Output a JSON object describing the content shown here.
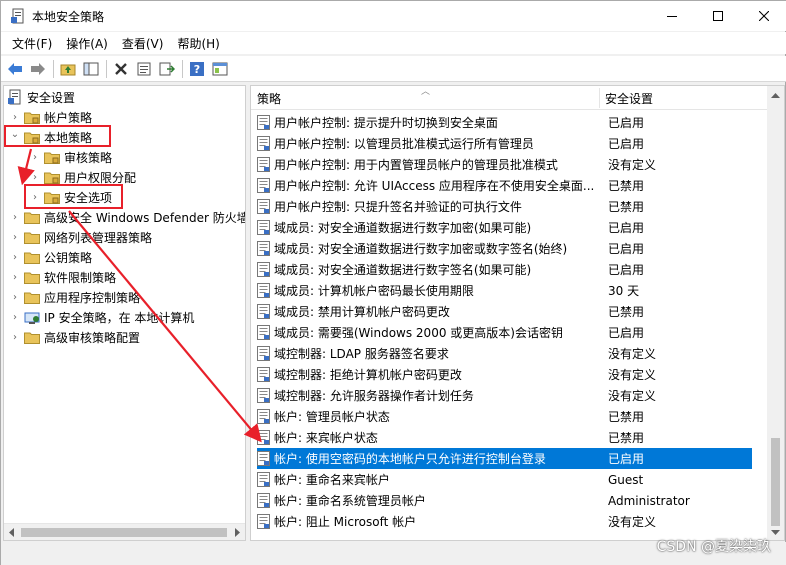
{
  "window": {
    "title": "本地安全策略",
    "controls": [
      "minimize-icon",
      "maximize-icon",
      "close-icon"
    ]
  },
  "menu": [
    "文件(F)",
    "操作(A)",
    "查看(V)",
    "帮助(H)"
  ],
  "toolbar": {
    "icons": [
      "back-arrow-icon",
      "forward-arrow-icon",
      "up-folder-icon",
      "show-hide-tree-icon",
      "delete-icon",
      "properties-icon",
      "export-list-icon",
      "help-icon",
      "console-view-icon"
    ]
  },
  "tree": {
    "root": "安全设置",
    "items": [
      {
        "label": "帐户策略",
        "level": 1,
        "expanded": false
      },
      {
        "label": "本地策略",
        "level": 1,
        "expanded": true
      },
      {
        "label": "审核策略",
        "level": 2,
        "expanded": false
      },
      {
        "label": "用户权限分配",
        "level": 2,
        "expanded": false
      },
      {
        "label": "安全选项",
        "level": 2,
        "expanded": false,
        "selected": true
      },
      {
        "label": "高级安全 Windows Defender 防火墙",
        "level": 1,
        "expanded": false
      },
      {
        "label": "网络列表管理器策略",
        "level": 1,
        "expanded": false
      },
      {
        "label": "公钥策略",
        "level": 1,
        "expanded": false
      },
      {
        "label": "软件限制策略",
        "level": 1,
        "expanded": false
      },
      {
        "label": "应用程序控制策略",
        "level": 1,
        "expanded": false
      },
      {
        "label": "IP 安全策略，在 本地计算机",
        "level": 1,
        "expanded": false
      },
      {
        "label": "高级审核策略配置",
        "level": 1,
        "expanded": false
      }
    ]
  },
  "list": {
    "columns": [
      "策略",
      "安全设置"
    ],
    "rows": [
      {
        "policy": "用户帐户控制: 提示提升时切换到安全桌面",
        "setting": "已启用"
      },
      {
        "policy": "用户帐户控制: 以管理员批准模式运行所有管理员",
        "setting": "已启用"
      },
      {
        "policy": "用户帐户控制: 用于内置管理员帐户的管理员批准模式",
        "setting": "没有定义"
      },
      {
        "policy": "用户帐户控制: 允许 UIAccess 应用程序在不使用安全桌面...",
        "setting": "已禁用"
      },
      {
        "policy": "用户帐户控制: 只提升签名并验证的可执行文件",
        "setting": "已禁用"
      },
      {
        "policy": "域成员: 对安全通道数据进行数字加密(如果可能)",
        "setting": "已启用"
      },
      {
        "policy": "域成员: 对安全通道数据进行数字加密或数字签名(始终)",
        "setting": "已启用"
      },
      {
        "policy": "域成员: 对安全通道数据进行数字签名(如果可能)",
        "setting": "已启用"
      },
      {
        "policy": "域成员: 计算机帐户密码最长使用期限",
        "setting": "30 天"
      },
      {
        "policy": "域成员: 禁用计算机帐户密码更改",
        "setting": "已禁用"
      },
      {
        "policy": "域成员: 需要强(Windows 2000 或更高版本)会话密钥",
        "setting": "已启用"
      },
      {
        "policy": "域控制器: LDAP 服务器签名要求",
        "setting": "没有定义"
      },
      {
        "policy": "域控制器: 拒绝计算机帐户密码更改",
        "setting": "没有定义"
      },
      {
        "policy": "域控制器: 允许服务器操作者计划任务",
        "setting": "没有定义"
      },
      {
        "policy": "帐户: 管理员帐户状态",
        "setting": "已禁用"
      },
      {
        "policy": "帐户: 来宾帐户状态",
        "setting": "已禁用"
      },
      {
        "policy": "帐户: 使用空密码的本地帐户只允许进行控制台登录",
        "setting": "已启用",
        "selected": true
      },
      {
        "policy": "帐户: 重命名来宾帐户",
        "setting": "Guest"
      },
      {
        "policy": "帐户: 重命名系统管理员帐户",
        "setting": "Administrator"
      },
      {
        "policy": "帐户: 阻止 Microsoft 帐户",
        "setting": "没有定义"
      }
    ]
  },
  "colors": {
    "selection": "#0078d7",
    "annotation": "#e8202a",
    "folder": "#e8c35a"
  },
  "watermark": "CSDN @夏染柒玖"
}
